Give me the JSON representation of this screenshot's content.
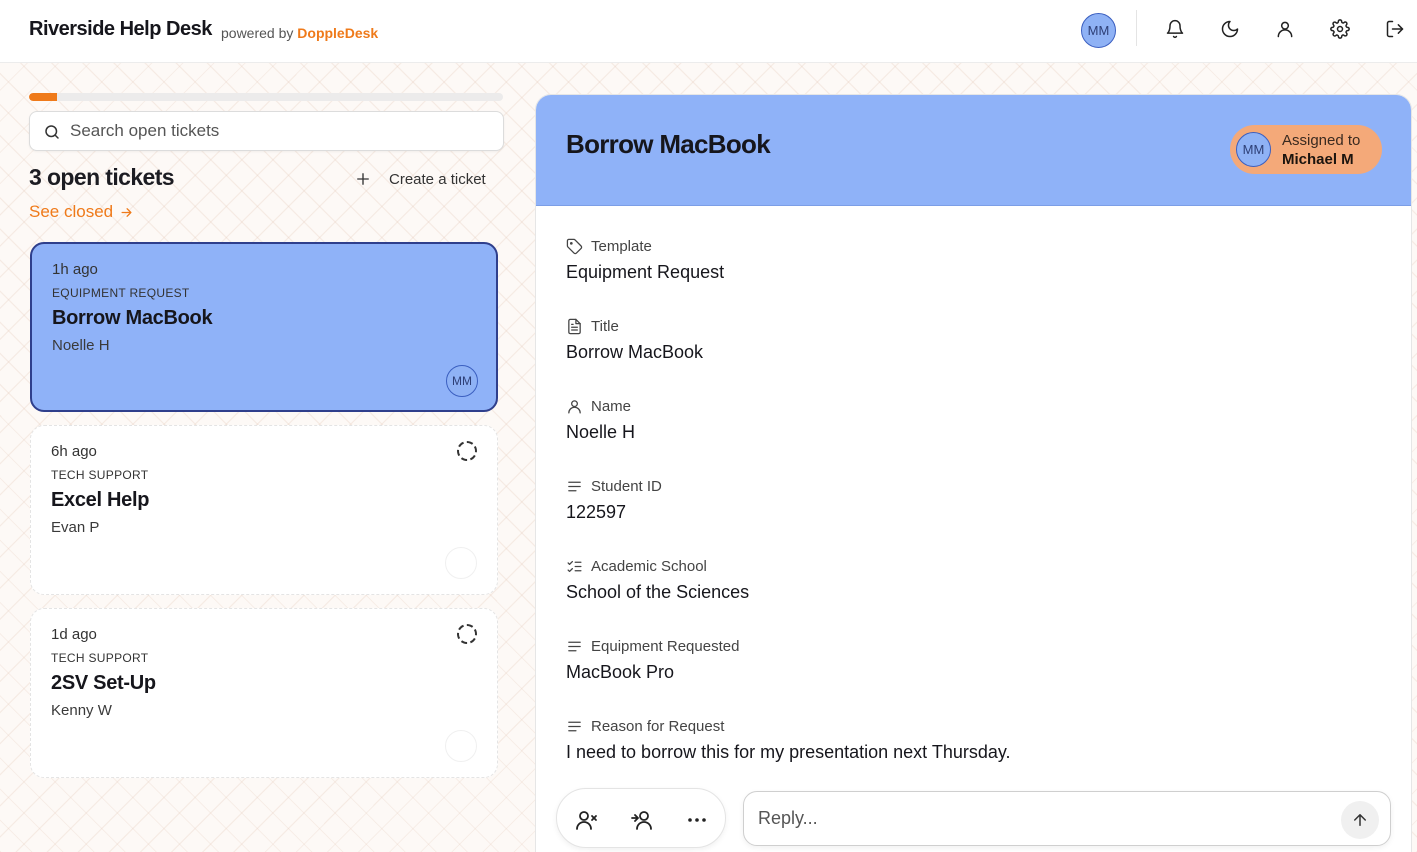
{
  "app": {
    "title": "Riverside Help Desk",
    "powered_prefix": "powered by",
    "powered_brand": "DoppleDesk",
    "accent_color": "#ef7a1a",
    "user_initials": "MM"
  },
  "header_icons": [
    "bell-icon",
    "moon-icon",
    "user-icon",
    "gear-icon",
    "logout-icon"
  ],
  "progress": {
    "fraction": 0.06
  },
  "search": {
    "placeholder": "Search open tickets"
  },
  "tickets_header": {
    "count_label": "3 open tickets",
    "create_label": "Create a ticket",
    "see_closed_label": "See closed"
  },
  "tickets": [
    {
      "time": "1h ago",
      "type": "Equipment Request",
      "title": "Borrow MacBook",
      "requester": "Noelle H",
      "assignee": "MM",
      "active": true
    },
    {
      "time": "6h ago",
      "type": "Tech Support",
      "title": "Excel Help",
      "requester": "Evan P",
      "assignee": "",
      "active": false
    },
    {
      "time": "1d ago",
      "type": "Tech Support",
      "title": "2SV Set-Up",
      "requester": "Kenny W",
      "assignee": "",
      "active": false
    }
  ],
  "detail": {
    "title": "Borrow MacBook",
    "assigned_label": "Assigned to",
    "assigned_name": "Michael M",
    "assigned_initials": "MM",
    "fields": [
      {
        "icon": "tag-icon",
        "label": "Template",
        "value": "Equipment Request"
      },
      {
        "icon": "document-icon",
        "label": "Title",
        "value": "Borrow MacBook"
      },
      {
        "icon": "user-icon",
        "label": "Name",
        "value": "Noelle H"
      },
      {
        "icon": "text-lines-icon",
        "label": "Student ID",
        "value": "122597"
      },
      {
        "icon": "checklist-icon",
        "label": "Academic School",
        "value": "School of the Sciences"
      },
      {
        "icon": "text-lines-icon",
        "label": "Equipment Requested",
        "value": "MacBook Pro"
      },
      {
        "icon": "text-lines-icon",
        "label": "Reason for Request",
        "value": "I need to borrow this for my presentation next Thursday."
      }
    ]
  },
  "reply": {
    "placeholder": "Reply..."
  },
  "actions": [
    "unassign-user-icon",
    "assign-user-icon",
    "more-icon"
  ]
}
